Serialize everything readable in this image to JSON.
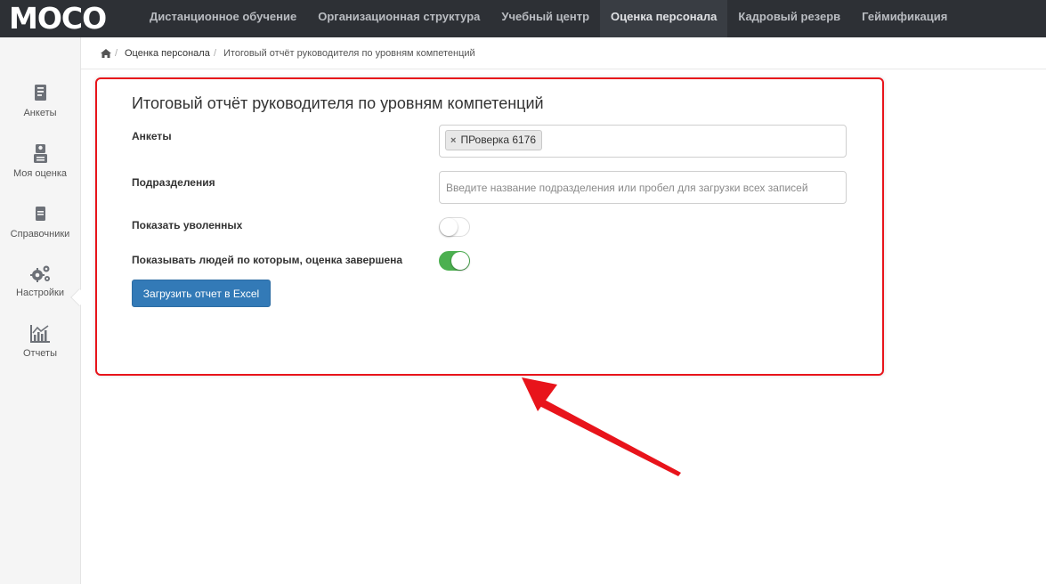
{
  "app": {
    "logo": "MOCO"
  },
  "nav": {
    "items": [
      {
        "label": "Дистанционное обучение",
        "active": false
      },
      {
        "label": "Организационная структура",
        "active": false
      },
      {
        "label": "Учебный центр",
        "active": false
      },
      {
        "label": "Оценка персонала",
        "active": true
      },
      {
        "label": "Кадровый резерв",
        "active": false
      },
      {
        "label": "Геймификация",
        "active": false
      }
    ]
  },
  "sidebar": {
    "items": [
      {
        "label": "Анкеты",
        "icon": "questionnaire-icon"
      },
      {
        "label": "Моя оценка",
        "icon": "my-rating-icon"
      },
      {
        "label": "Справочники",
        "icon": "reference-book-icon"
      },
      {
        "label": "Настройки",
        "icon": "gears-icon"
      },
      {
        "label": "Отчеты",
        "icon": "chart-icon",
        "active": true
      }
    ]
  },
  "breadcrumb": {
    "home_icon": "home-icon",
    "link": "Оценка персонала",
    "current": "Итоговый отчёт руководителя по уровням компетенций"
  },
  "form": {
    "title": "Итоговый отчёт руководителя по уровням компетенций",
    "questionnaires_label": "Анкеты",
    "questionnaires_tag": "ПРоверка 6176",
    "tag_remove": "×",
    "departments_label": "Подразделения",
    "departments_placeholder": "Введите название подразделения или пробел для загрузки всех записей",
    "show_dismissed_label": "Показать уволенных",
    "show_dismissed": false,
    "show_completed_label": "Показывать людей по которым, оценка завершена",
    "show_completed": true,
    "submit_label": "Загрузить отчет в Excel"
  },
  "colors": {
    "topbar": "#2d3035",
    "accent_button": "#337ab7",
    "toggle_on": "#4cb050",
    "highlight": "#e8141b"
  }
}
